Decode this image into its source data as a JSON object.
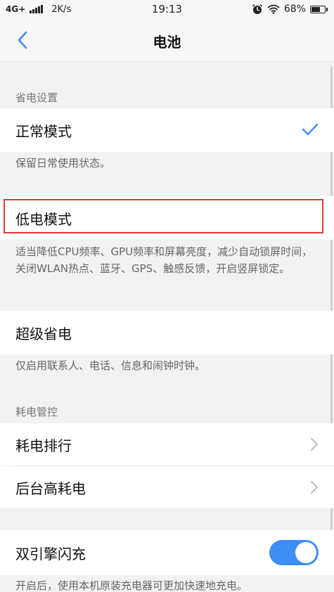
{
  "status_bar": {
    "network": "4G+",
    "speed": "2K/s",
    "time": "19:13",
    "battery": "68%",
    "battery_level": 0.68,
    "icons": [
      "signal-icon",
      "alarm-icon",
      "wifi-icon",
      "battery-icon"
    ]
  },
  "nav": {
    "title": "电池",
    "back_icon": "chevron-left-icon"
  },
  "power_settings": {
    "header": "省电设置",
    "normal_mode": {
      "label": "正常模式",
      "selected": true,
      "description": "保留日常使用状态。"
    },
    "low_power_mode": {
      "label": "低电模式",
      "description": "适当降低CPU频率、GPU频率和屏幕亮度，减少自动锁屏时间，关闭WLAN热点、蓝牙、GPS、触感反馈，开启竖屏锁定。"
    },
    "super_saver": {
      "label": "超级省电",
      "description": "仅启用联系人、电话、信息和闹钟时钟。"
    }
  },
  "power_control": {
    "header": "耗电管控",
    "ranking_label": "耗电排行",
    "background_label": "后台高耗电"
  },
  "dual_engine": {
    "label": "双引擎闪充",
    "enabled": true,
    "description": "开启后，使用本机原装充电器可更加快速地充电。"
  },
  "colors": {
    "accent": "#3d8ef5",
    "highlight": "#e53935"
  }
}
